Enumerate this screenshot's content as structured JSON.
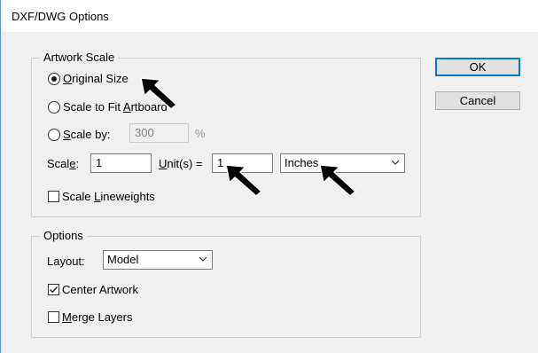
{
  "window": {
    "title": "DXF/DWG Options"
  },
  "artwork_scale": {
    "legend": "Artwork Scale",
    "original_size": {
      "mnemonic": "O",
      "rest": "riginal Size",
      "selected": true
    },
    "scale_to_fit": {
      "prefix": "Scale to Fit ",
      "mnemonic": "A",
      "rest": "rtboard",
      "selected": false
    },
    "scale_by": {
      "mnemonic": "S",
      "rest": "cale by:",
      "value": "300",
      "unit": "%",
      "selected": false
    },
    "scale_row": {
      "scale_prefix": "Scal",
      "scale_mnemonic": "e",
      "scale_suffix": ":",
      "scale_value": "1",
      "units_mnemonic": "U",
      "units_rest": "nit(s) =",
      "units_value": "1",
      "units_selected": "Inches"
    },
    "scale_lineweights": {
      "prefix": "Scale ",
      "mnemonic": "L",
      "rest": "ineweights",
      "checked": false
    }
  },
  "options": {
    "legend": "Options",
    "layout_label": "Layout:",
    "layout_selected": "Model",
    "center_artwork": {
      "label": "Center Artwork",
      "checked": true
    },
    "merge_layers": {
      "mnemonic": "M",
      "rest": "erge Layers",
      "checked": false
    }
  },
  "buttons": {
    "ok": "OK",
    "cancel": "Cancel"
  },
  "icons": {
    "chevron": "chevron-down-icon",
    "pointer": "pointer-arrow-icon",
    "check": "check-icon"
  }
}
